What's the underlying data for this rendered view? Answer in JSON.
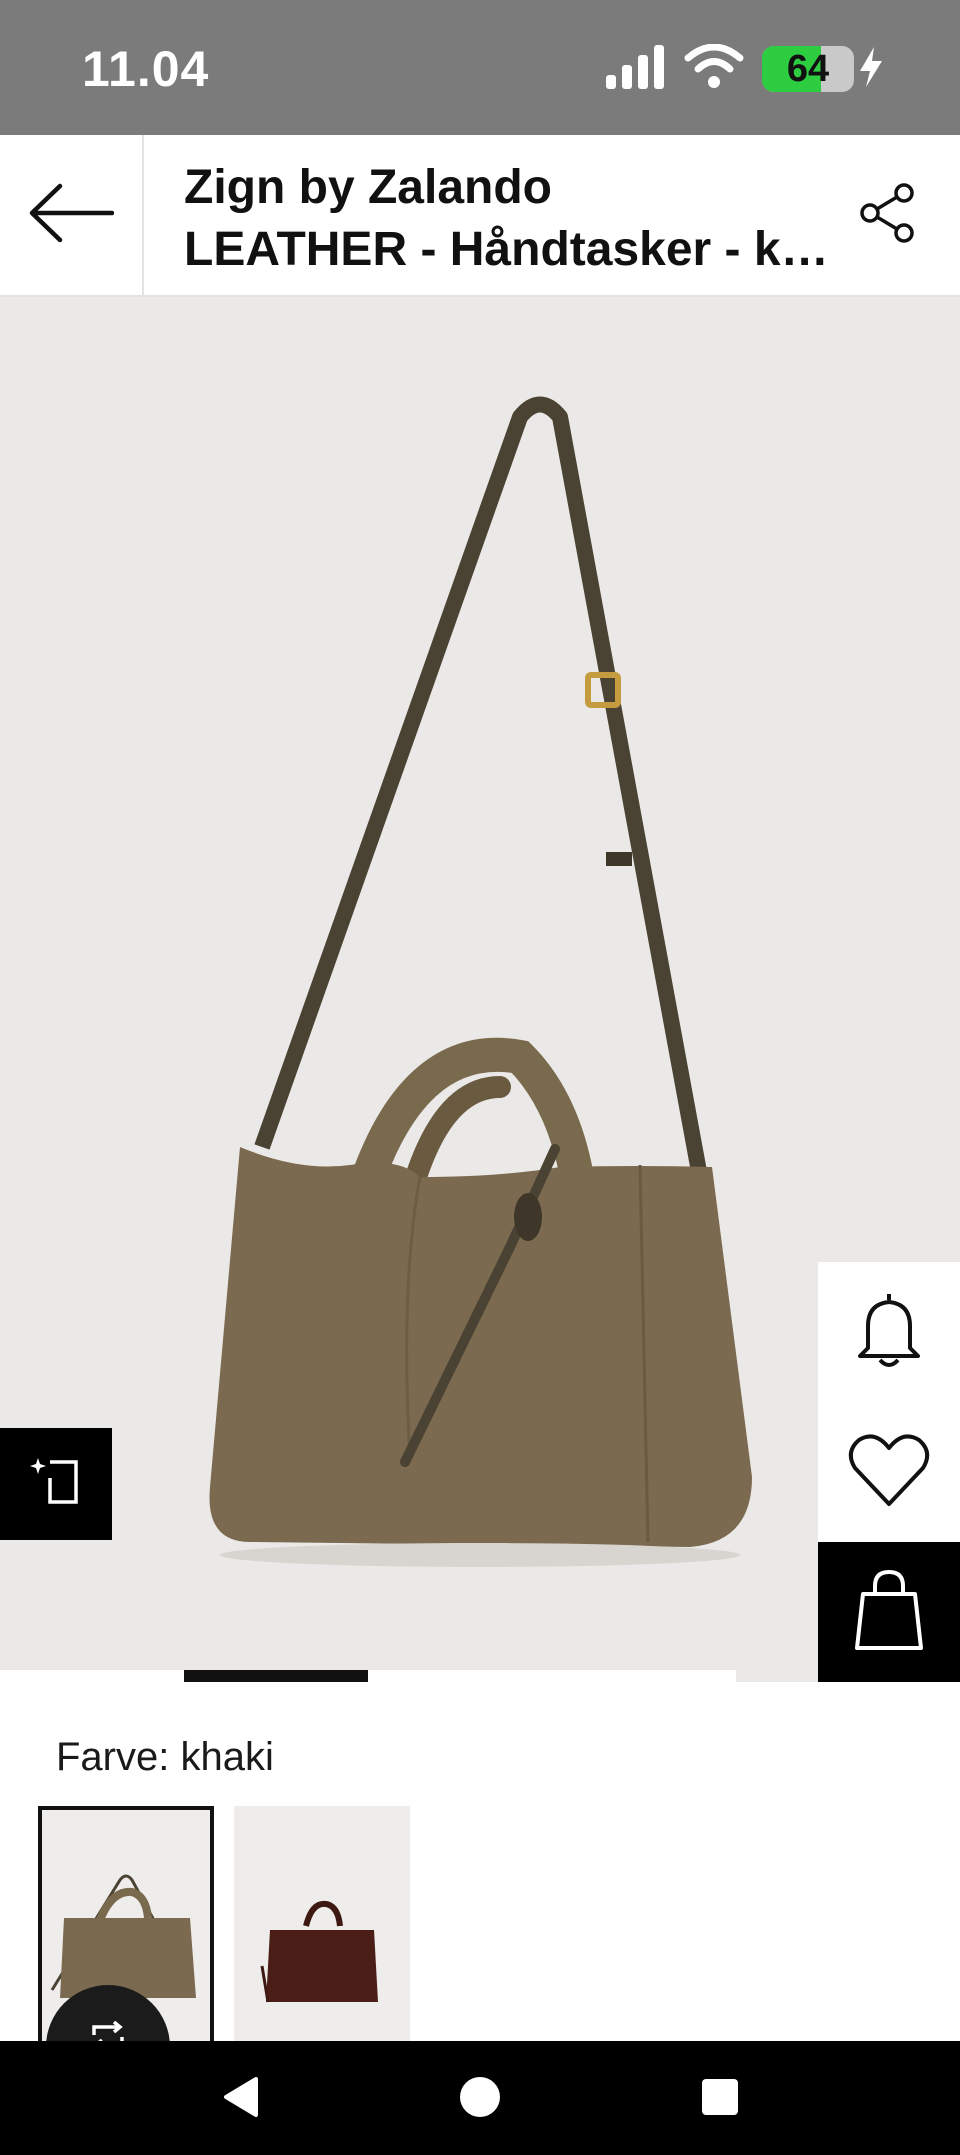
{
  "status_bar": {
    "time": "11.04",
    "battery_level": "64",
    "battery_fraction": 0.64,
    "icons": [
      "signal-icon",
      "wifi-icon",
      "battery-icon",
      "charging-icon"
    ]
  },
  "header": {
    "title_line1": "Zign by Zalando",
    "title_line2": "LEATHER - Håndtasker - khaki",
    "back_icon": "arrow-left-icon",
    "share_icon": "share-icon"
  },
  "gallery": {
    "active_index": 2,
    "image_alt": "khaki suede tote bag with long shoulder strap"
  },
  "side_actions": {
    "icons": [
      "bell-icon",
      "heart-icon",
      "shopping-bag-icon"
    ]
  },
  "color": {
    "label": "Farve: khaki",
    "swatches": [
      {
        "name": "khaki",
        "selected": true,
        "color": "#7b6a4f"
      },
      {
        "name": "dark brown",
        "selected": false,
        "color": "#4a1e17"
      }
    ]
  },
  "colors": {
    "status_bar_bg": "#7b7b7b",
    "battery_green": "#2ecc40",
    "image_bg": "#ebe9e7",
    "bag_color": "#7b6a4f",
    "strap_color": "#4a4232"
  },
  "nav": {
    "icons": [
      "nav-back-icon",
      "nav-home-icon",
      "nav-recents-icon"
    ]
  }
}
